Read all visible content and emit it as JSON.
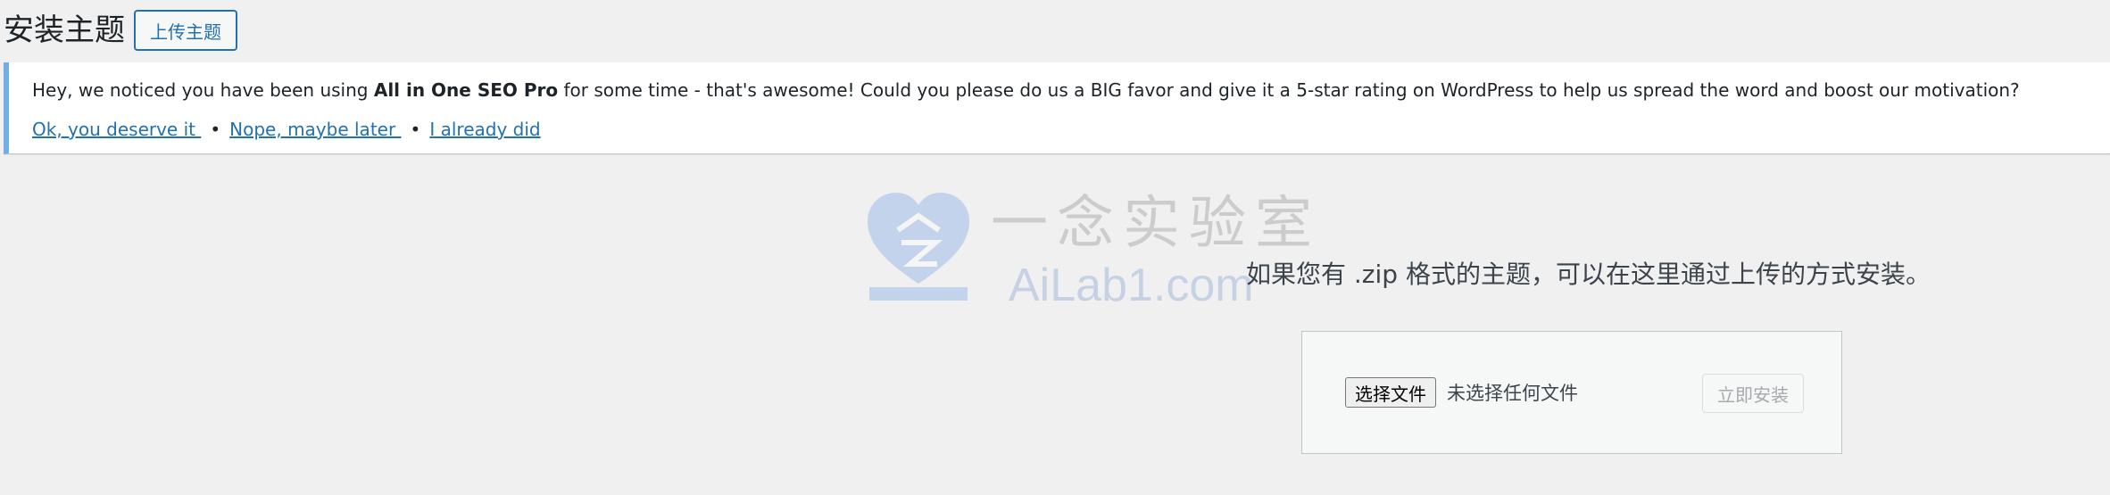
{
  "header": {
    "title": "安装主题",
    "upload_button": "上传主题"
  },
  "notice": {
    "text_before": "Hey, we noticed you have been using ",
    "plugin_name": "All in One SEO Pro",
    "text_after": " for some time - that's awesome! Could you please do us a BIG favor and give it a 5-star rating on WordPress to help us spread the word and boost our motivation?",
    "links": {
      "deserve": "Ok, you deserve it ",
      "later": "Nope, maybe later ",
      "did": "I already did"
    },
    "separator": "•",
    "accent_color": "#72aee6"
  },
  "watermark": {
    "cn_text": "一念实验室",
    "en_text": "AiLab1.com",
    "icon": "heart-logo-icon"
  },
  "upload": {
    "description": "如果您有 .zip 格式的主题，可以在这里通过上传的方式安装。",
    "choose_file_button": "选择文件",
    "file_status": "未选择任何文件",
    "install_button": "立即安装"
  },
  "colors": {
    "link": "#2271b1",
    "background": "#f0f0f1"
  }
}
